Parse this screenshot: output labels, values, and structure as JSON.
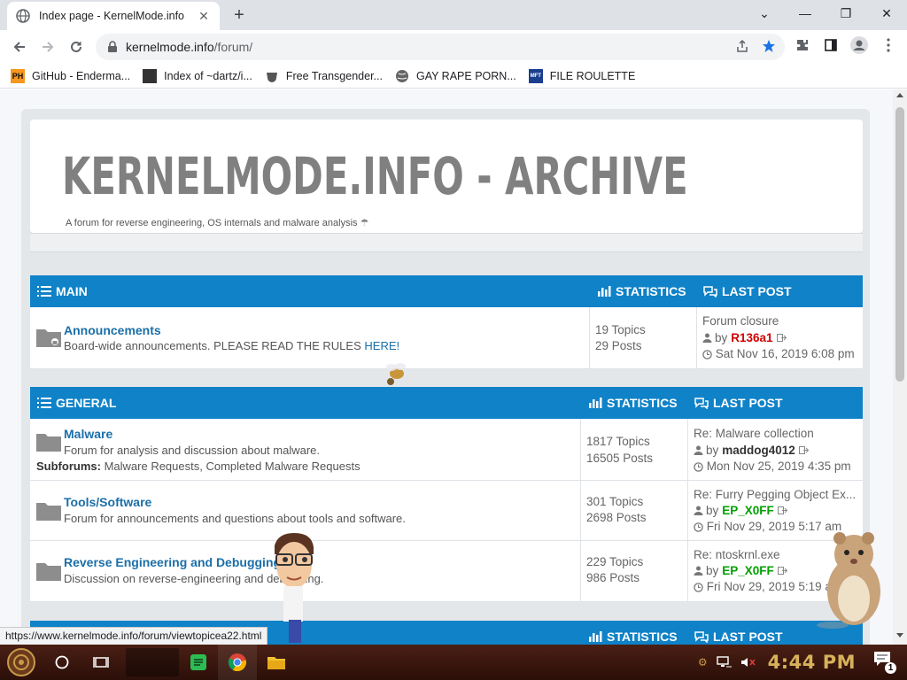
{
  "browser": {
    "tab_title": "Index page - KernelMode.info",
    "url_host": "kernelmode.info",
    "url_path": "/forum/",
    "bookmarks": [
      {
        "icon_text": "PH",
        "icon_color": "#f7971e",
        "label": "GitHub - Enderma..."
      },
      {
        "icon_text": "",
        "icon_color": "#333333",
        "label": "Index of ~dartz/i..."
      },
      {
        "icon_text": "",
        "icon_color": "#555555",
        "label": "Free Transgender..."
      },
      {
        "icon_text": "",
        "icon_color": "#666666",
        "label": "GAY RAPE PORN..."
      },
      {
        "icon_text": "MFT",
        "icon_color": "#1a3f8f",
        "label": "FILE ROULETTE"
      }
    ],
    "status_url": "https://www.kernelmode.info/forum/viewtopicea22.html"
  },
  "site": {
    "title": "KERNELMODE.INFO - ARCHIVE",
    "description": "A forum for reverse engineering, OS internals and malware analysis"
  },
  "sections": [
    {
      "category": "MAIN",
      "stat_label": "STATISTICS",
      "last_label": "LAST POST",
      "forums": [
        {
          "name": "Announcements",
          "description": "Board-wide announcements. PLEASE READ THE RULES",
          "desc_link": "HERE!",
          "topics": "19 Topics",
          "posts": "29 Posts",
          "lp_title": "Forum closure",
          "lp_by": "by",
          "lp_user": "R136a1",
          "lp_user_color": "#d00000",
          "lp_date": "Sat Nov 16, 2019 6:08 pm"
        }
      ]
    },
    {
      "category": "GENERAL",
      "stat_label": "STATISTICS",
      "last_label": "LAST POST",
      "forums": [
        {
          "name": "Malware",
          "description": "Forum for analysis and discussion about malware.",
          "subforums_label": "Subforums:",
          "subforums": "Malware Requests, Completed Malware Requests",
          "topics": "1817 Topics",
          "posts": "16505 Posts",
          "lp_title": "Re: Malware collection",
          "lp_by": "by",
          "lp_user": "maddog4012",
          "lp_user_color": "#333333",
          "lp_date": "Mon Nov 25, 2019 4:35 pm"
        },
        {
          "name": "Tools/Software",
          "description": "Forum for announcements and questions about tools and software.",
          "topics": "301 Topics",
          "posts": "2698 Posts",
          "lp_title": "Re: Furry Pegging Object Ex...",
          "lp_by": "by",
          "lp_user": "EP_X0FF",
          "lp_user_color": "#00a000",
          "lp_date": "Fri Nov 29, 2019 5:17 am"
        },
        {
          "name": "Reverse Engineering and Debugging",
          "description": "Discussion on reverse-engineering and debugging.",
          "topics": "229 Topics",
          "posts": "986 Posts",
          "lp_title": "Re: ntoskrnl.exe",
          "lp_by": "by",
          "lp_user": "EP_X0FF",
          "lp_user_color": "#00a000",
          "lp_date": "Fri Nov 29, 2019 5:19 am"
        }
      ]
    },
    {
      "category": "",
      "stat_label": "STATISTICS",
      "last_label": "LAST POST"
    }
  ],
  "taskbar": {
    "clock": "4:44 PM",
    "notification_count": "1"
  },
  "colors": {
    "accent": "#0f82c8",
    "link": "#1b6fa8"
  }
}
